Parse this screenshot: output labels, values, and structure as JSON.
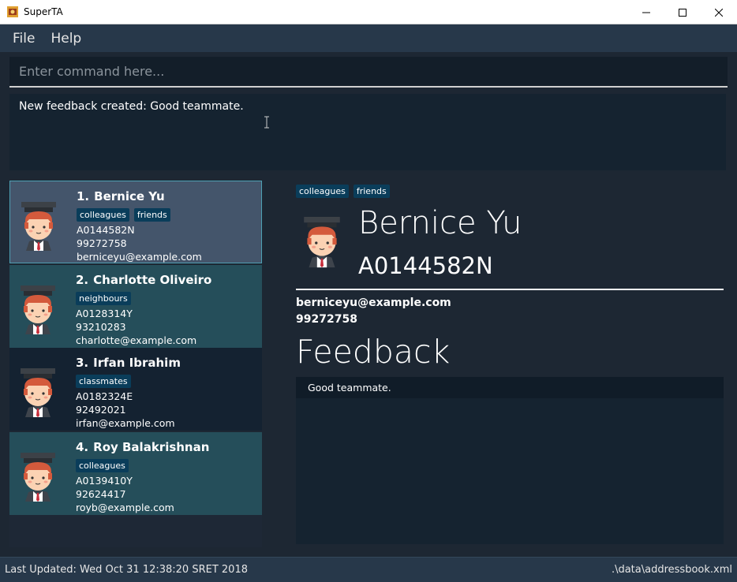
{
  "window": {
    "title": "SuperTA"
  },
  "menu": {
    "file": "File",
    "help": "Help"
  },
  "command": {
    "placeholder": "Enter command here..."
  },
  "result": {
    "message": "New feedback created: Good teammate."
  },
  "persons": [
    {
      "index": "1.",
      "name": "Bernice Yu",
      "tags": [
        "colleagues",
        "friends"
      ],
      "id": "A0144582N",
      "phone": "99272758",
      "email": "berniceyu@example.com"
    },
    {
      "index": "2.",
      "name": "Charlotte Oliveiro",
      "tags": [
        "neighbours"
      ],
      "id": "A0128314Y",
      "phone": "93210283",
      "email": "charlotte@example.com"
    },
    {
      "index": "3.",
      "name": "Irfan Ibrahim",
      "tags": [
        "classmates"
      ],
      "id": "A0182324E",
      "phone": "92492021",
      "email": "irfan@example.com"
    },
    {
      "index": "4.",
      "name": "Roy Balakrishnan",
      "tags": [
        "colleagues"
      ],
      "id": "A0139410Y",
      "phone": "92624417",
      "email": "royb@example.com"
    }
  ],
  "detail": {
    "tags": [
      "colleagues",
      "friends"
    ],
    "name": "Bernice Yu",
    "id": "A0144582N",
    "email": "berniceyu@example.com",
    "phone": "99272758",
    "feedback_heading": "Feedback",
    "feedback": [
      "Good teammate."
    ]
  },
  "status": {
    "last_updated": "Last Updated: Wed Oct 31 12:38:20 SRET 2018",
    "file_path": ".\\data\\addressbook.xml"
  }
}
